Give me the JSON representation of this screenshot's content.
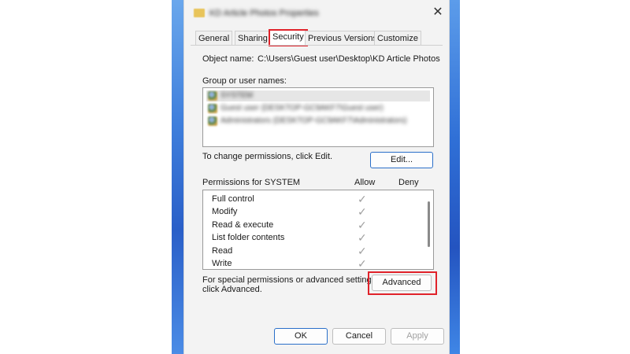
{
  "dialog": {
    "title": "KD Article Photos Properties",
    "close_glyph": "✕"
  },
  "tabs": [
    {
      "label": "General"
    },
    {
      "label": "Sharing"
    },
    {
      "label": "Security"
    },
    {
      "label": "Previous Versions"
    },
    {
      "label": "Customize"
    }
  ],
  "security": {
    "object_name_label": "Object name:",
    "object_name_value": "C:\\Users\\Guest user\\Desktop\\KD Article Photos",
    "group_label": "Group or user names:",
    "users": [
      {
        "name": "SYSTEM"
      },
      {
        "name": "Guest user (DESKTOP-GC9AKF7\\Guest user)"
      },
      {
        "name": "Administrators (DESKTOP-GC9AKF7\\Administrators)"
      }
    ],
    "change_text": "To change permissions, click Edit.",
    "edit_label": "Edit...",
    "permissions_label": "Permissions for SYSTEM",
    "allow_header": "Allow",
    "deny_header": "Deny",
    "permissions": [
      {
        "name": "Full control",
        "allow": true
      },
      {
        "name": "Modify",
        "allow": true
      },
      {
        "name": "Read & execute",
        "allow": true
      },
      {
        "name": "List folder contents",
        "allow": true
      },
      {
        "name": "Read",
        "allow": true
      },
      {
        "name": "Write",
        "allow": true
      }
    ],
    "special_text_1": "For special permissions or advanced settings,",
    "special_text_2": "click Advanced.",
    "advanced_label": "Advanced"
  },
  "footer": {
    "ok_label": "OK",
    "cancel_label": "Cancel",
    "apply_label": "Apply"
  },
  "check_glyph": "✓",
  "colors": {
    "highlight": "#e0222a",
    "focus": "#2a6fc9",
    "wallpaper": "#2f6fd6"
  }
}
